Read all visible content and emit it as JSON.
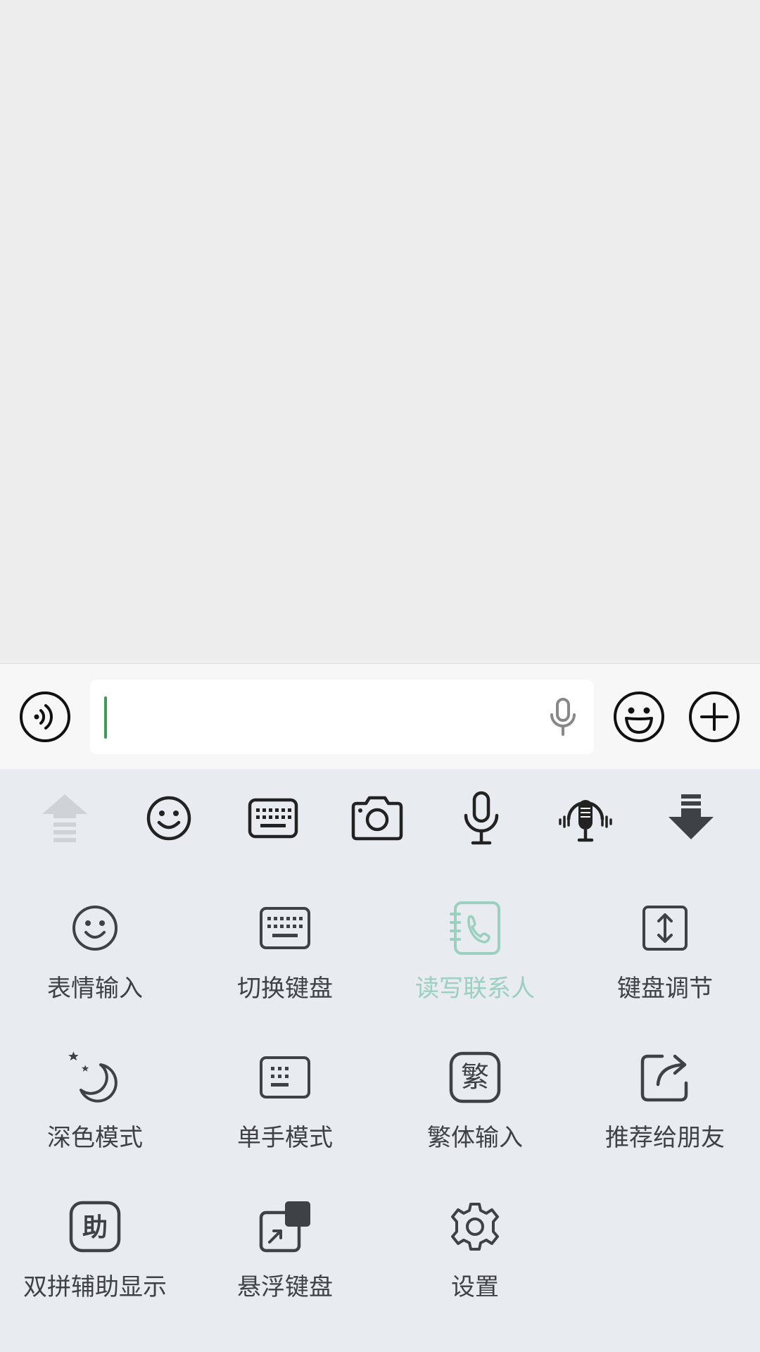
{
  "input_bar": {
    "text_value": "",
    "icons": [
      "voice-mode-icon",
      "microphone-icon",
      "emoji-icon",
      "plus-icon"
    ]
  },
  "toolbar": {
    "icons": [
      "arrow-up-icon",
      "smiley-icon",
      "keyboard-icon",
      "camera-icon",
      "microphone-icon",
      "voice-podcast-icon",
      "arrow-down-icon"
    ]
  },
  "grid": {
    "items": [
      {
        "label": "表情输入",
        "icon": "smiley-icon"
      },
      {
        "label": "切换键盘",
        "icon": "keyboard-icon"
      },
      {
        "label": "读写联系人",
        "icon": "contacts-book-icon",
        "disabled": true
      },
      {
        "label": "键盘调节",
        "icon": "resize-vertical-icon"
      },
      {
        "label": "深色模式",
        "icon": "moon-stars-icon"
      },
      {
        "label": "单手模式",
        "icon": "compact-keyboard-icon"
      },
      {
        "label": "繁体输入",
        "icon": "traditional-char-icon",
        "glyph": "繁"
      },
      {
        "label": "推荐给朋友",
        "icon": "share-icon"
      },
      {
        "label": "双拼辅助显示",
        "icon": "assist-char-icon",
        "glyph": "助"
      },
      {
        "label": "悬浮键盘",
        "icon": "floating-keyboard-icon"
      },
      {
        "label": "设置",
        "icon": "gear-icon"
      }
    ]
  },
  "colors": {
    "chat_background": "#ededed",
    "input_bar_background": "#f7f7f7",
    "keyboard_panel_background": "#e8ebef",
    "caret": "#3e9b5a",
    "icon_dark": "#3e4145",
    "disabled_accent": "#9bcfbe"
  }
}
